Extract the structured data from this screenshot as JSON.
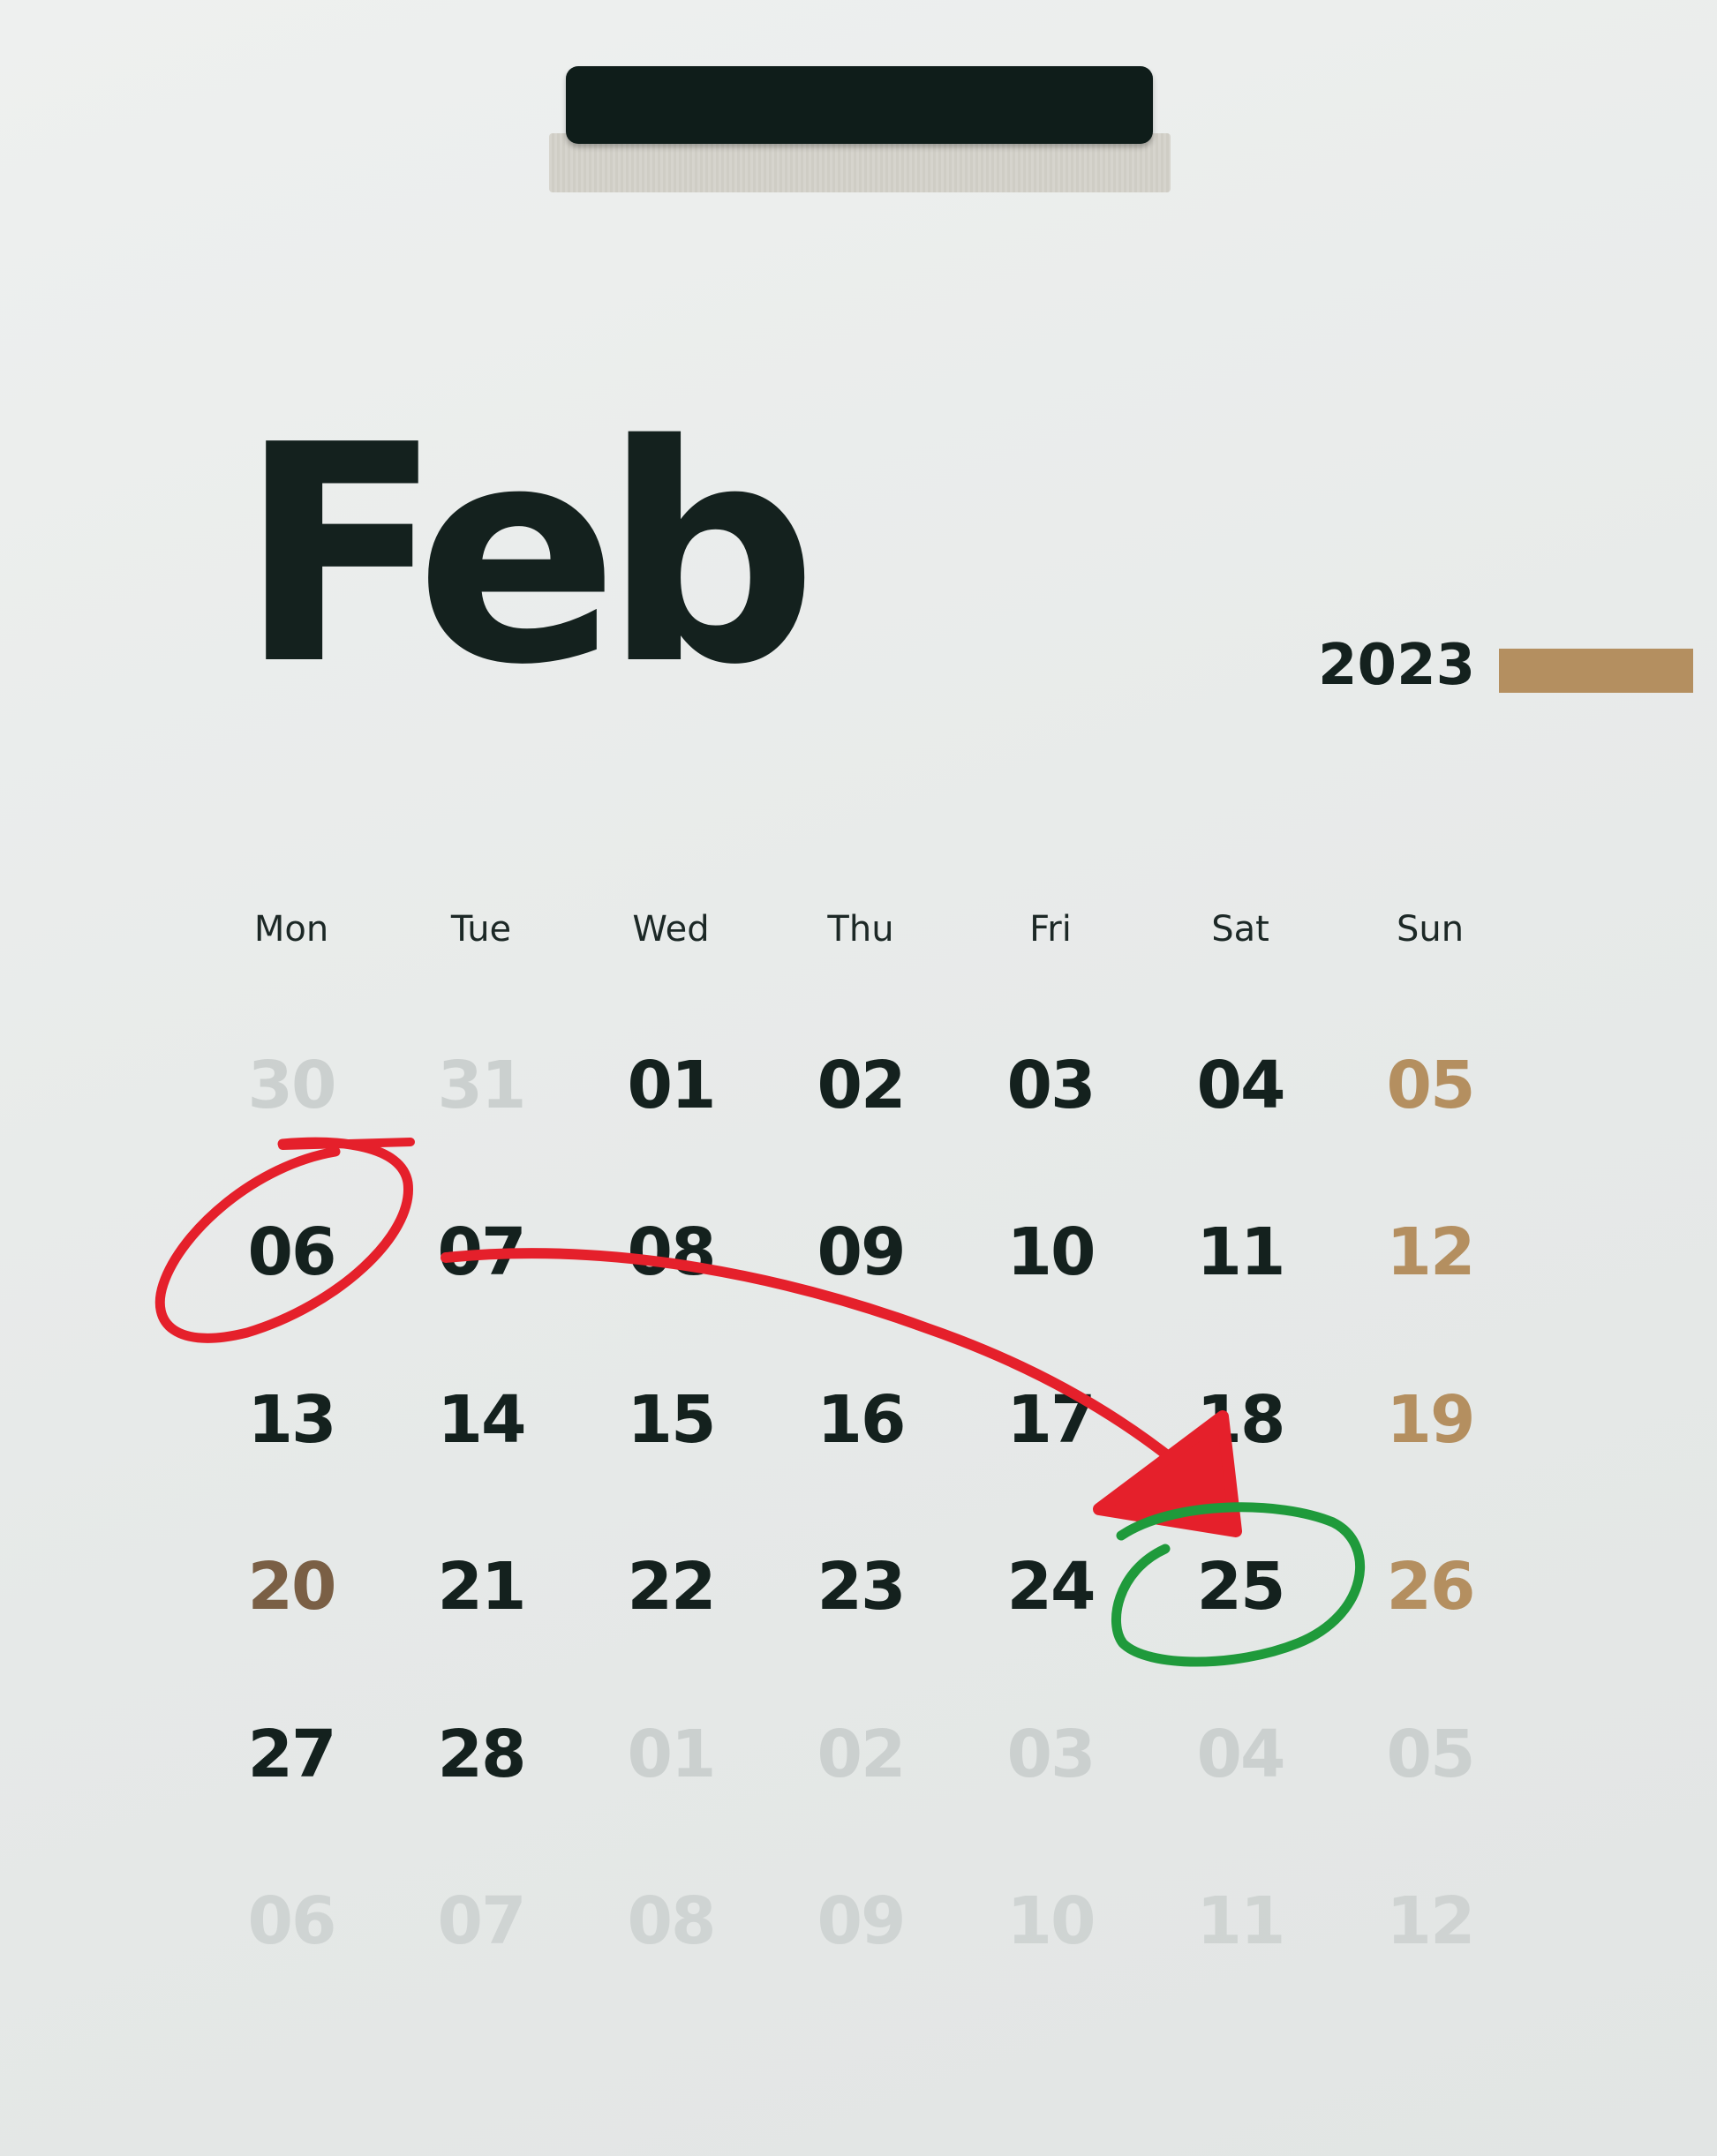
{
  "calendar": {
    "month": "Feb",
    "year": "2023",
    "weekdays": [
      "Mon",
      "Tue",
      "Wed",
      "Thu",
      "Fri",
      "Sat",
      "Sun"
    ],
    "weeks": [
      [
        "30",
        "31",
        "01",
        "02",
        "03",
        "04",
        "05"
      ],
      [
        "06",
        "07",
        "08",
        "09",
        "10",
        "11",
        "12"
      ],
      [
        "13",
        "14",
        "15",
        "16",
        "17",
        "18",
        "19"
      ],
      [
        "20",
        "21",
        "22",
        "23",
        "24",
        "25",
        "26"
      ],
      [
        "27",
        "28",
        "01",
        "02",
        "03",
        "04",
        "05"
      ],
      [
        "06",
        "07",
        "08",
        "09",
        "10",
        "11",
        "12"
      ]
    ]
  },
  "annotations": {
    "start_circle": {
      "day": "06",
      "color": "#e5202b"
    },
    "arrow": {
      "from": "07",
      "to": "25",
      "color": "#e5202b"
    },
    "end_circle": {
      "day": "25",
      "color": "#1f9a3b"
    }
  },
  "colors": {
    "ink": "#14211e",
    "faded": "#c7cccb",
    "weekend": "#b48f60",
    "paper": "#e9ebea"
  }
}
